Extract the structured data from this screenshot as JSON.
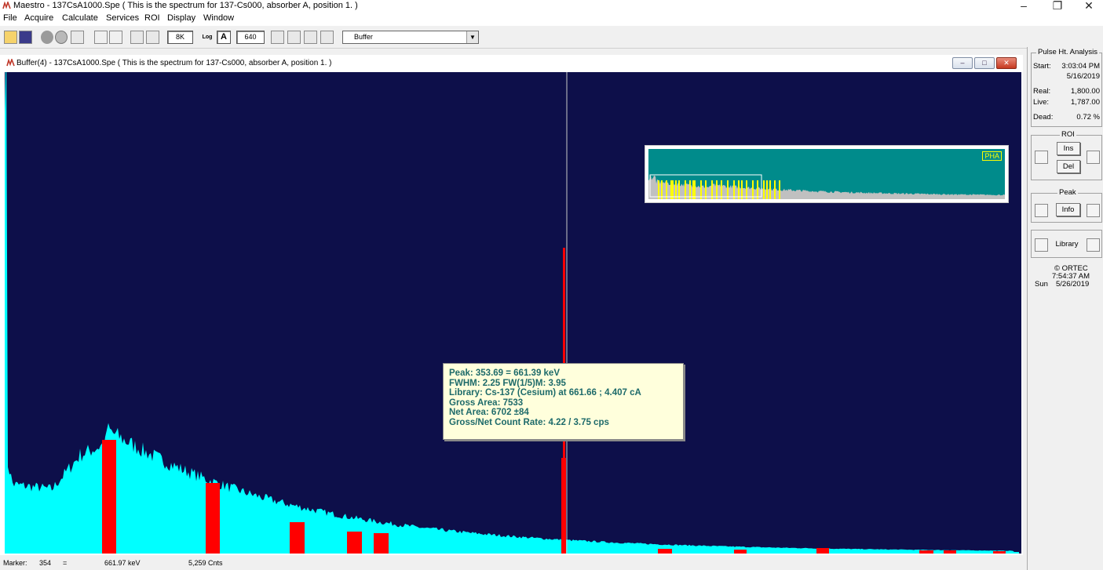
{
  "window": {
    "title": "Maestro - 137CsA1000.Spe ( This is the spectrum for 137-Cs000, absorber A, position 1. )",
    "controls": [
      "–",
      "❐",
      "✕"
    ]
  },
  "menu": [
    "File",
    "Acquire",
    "Calculate",
    "Services",
    "ROI",
    "Display",
    "Window"
  ],
  "toolbar": {
    "channels_label": "8K",
    "log_label": "Log",
    "auto_label": "A",
    "vscale_value": "640",
    "detector_select": "Buffer",
    "icons": [
      "open-icon",
      "save-icon",
      "start-icon",
      "stop-icon",
      "clear-icon",
      "roi-icon",
      "roi-clear-icon",
      "mark-peak-icon",
      "unmark-peak-icon",
      "zoom-in-icon",
      "zoom-out-icon",
      "center-icon",
      "full-view-icon"
    ]
  },
  "spectrum_window": {
    "title": "Buffer(4) - 137CsA1000.Spe ( This is the spectrum for 137-Cs000, absorber A, position 1. )",
    "colors": {
      "background": "#0d0f4a",
      "spectrum": "#00ffff",
      "roi": "#ff0000",
      "marker": "#c8c8c8",
      "inset_bg": "#008b8b",
      "inset_spectrum": "#c0c0c0",
      "inset_roi": "#ffff00"
    },
    "inset_label": "PHA",
    "tooltip_lines": [
      "Peak: 353.69 = 661.39 keV",
      "FWHM: 2.25  FW(1/5)M: 3.95",
      "Library: Cs-137 (Cesium) at 661.66 ;  4.407 cA",
      "Gross Area: 7533",
      "Net Area: 6702 ±84",
      "Gross/Net Count Rate: 4.22 / 3.75 cps"
    ]
  },
  "status": {
    "marker_label": "Marker:",
    "marker_channel": "354",
    "equals": "=",
    "energy": "661.97  keV",
    "counts": "5,259  Cnts"
  },
  "panel": {
    "pha_title": "Pulse Ht. Analysis",
    "start_label": "Start:",
    "start_time": "3:03:04 PM",
    "start_date": "5/16/2019",
    "real_label": "Real:",
    "real_value": "1,800.00",
    "live_label": "Live:",
    "live_value": "1,787.00",
    "dead_label": "Dead:",
    "dead_value": "0.72  %",
    "roi_title": "ROI",
    "ins_label": "Ins",
    "del_label": "Del",
    "peak_title": "Peak",
    "info_label": "Info",
    "library_label": "Library",
    "company": "© ORTEC",
    "clock_time": "7:54:37 AM",
    "clock_day": "Sun",
    "clock_date": "5/26/2019"
  }
}
